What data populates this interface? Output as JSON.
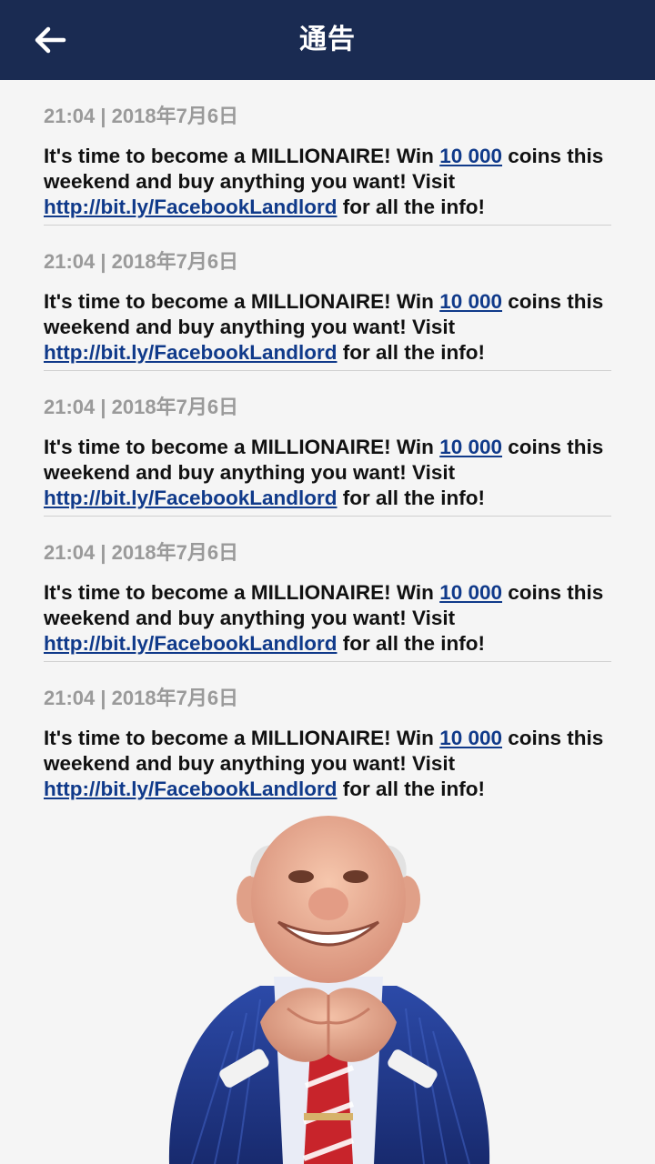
{
  "header": {
    "title": "通告",
    "back_icon": "arrow-left-icon"
  },
  "notices": [
    {
      "meta": "21:04 | 2018年7月6日",
      "text_1": "It's time to become a MILLIONAIRE! Win ",
      "coins_link": "10 000",
      "text_2": " coins this weekend and buy anything you want! Visit ",
      "url_link": "http://bit.ly/FacebookLandlord",
      "text_3": " for all the info!"
    },
    {
      "meta": "21:04 | 2018年7月6日",
      "text_1": "It's time to become a MILLIONAIRE! Win ",
      "coins_link": "10 000",
      "text_2": " coins this weekend and buy anything you want! Visit ",
      "url_link": "http://bit.ly/FacebookLandlord",
      "text_3": " for all the info!"
    },
    {
      "meta": "21:04 | 2018年7月6日",
      "text_1": "It's time to become a MILLIONAIRE! Win ",
      "coins_link": "10 000",
      "text_2": " coins this weekend and buy anything you want! Visit ",
      "url_link": "http://bit.ly/FacebookLandlord",
      "text_3": " for all the info!"
    },
    {
      "meta": "21:04 | 2018年7月6日",
      "text_1": "It's time to become a MILLIONAIRE! Win ",
      "coins_link": "10 000",
      "text_2": " coins this weekend and buy anything you want! Visit ",
      "url_link": "http://bit.ly/FacebookLandlord",
      "text_3": " for all the info!"
    },
    {
      "meta": "21:04 | 2018年7月6日",
      "text_1": "It's time to become a MILLIONAIRE! Win ",
      "coins_link": "10 000",
      "text_2": " coins this weekend and buy anything you want! Visit ",
      "url_link": "http://bit.ly/FacebookLandlord",
      "text_3": " for all the info!"
    }
  ],
  "colors": {
    "header_bg": "#1a2b52",
    "link": "#103a8a",
    "meta_text": "#9a9a9a"
  }
}
